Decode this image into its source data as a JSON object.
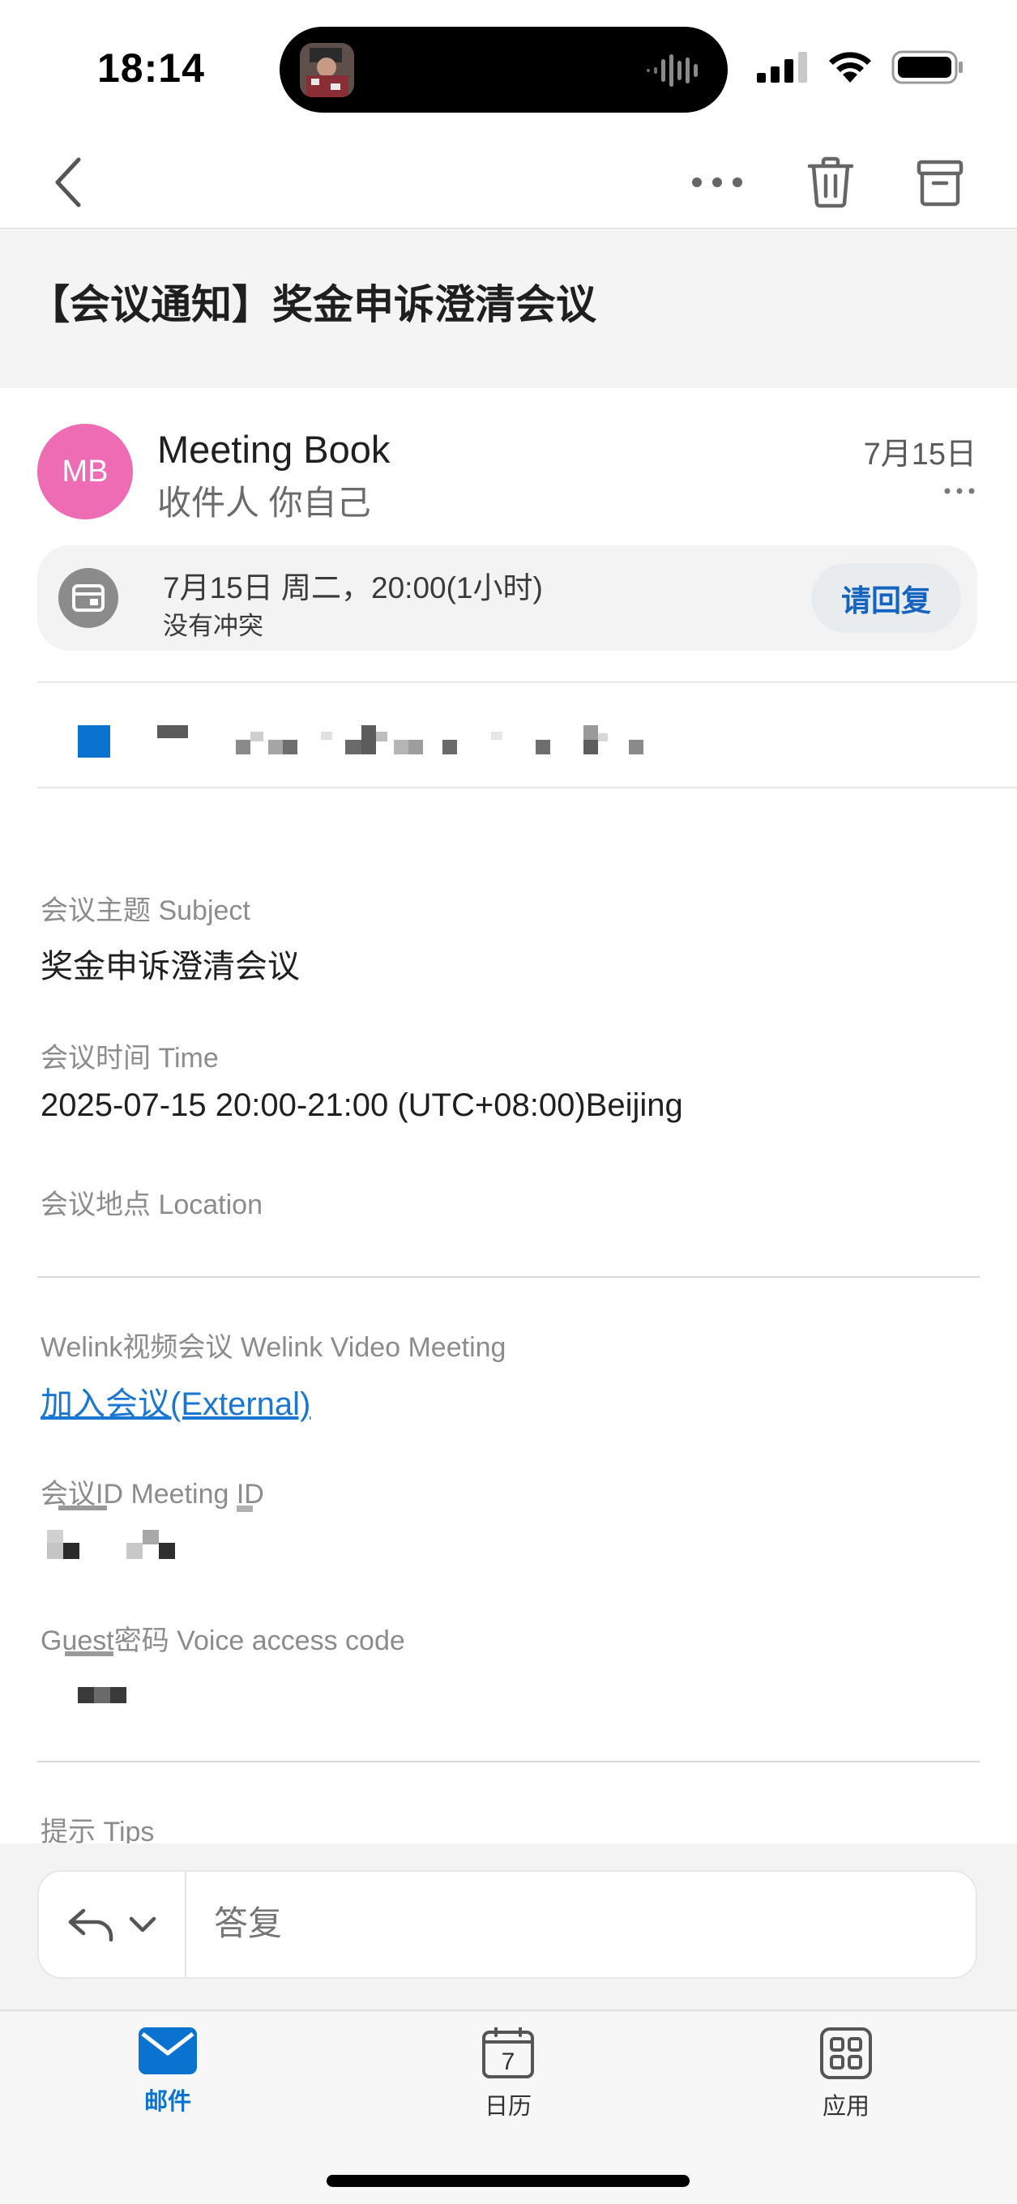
{
  "status_bar": {
    "time": "18:14"
  },
  "email": {
    "subject": "【会议通知】奖金申诉澄清会议",
    "sender": {
      "initials": "MB",
      "name": "Meeting Book",
      "avatar_color": "#ee6cb4"
    },
    "recipient": "收件人 你自己",
    "date": "7月15日"
  },
  "event_card": {
    "time": "7月15日 周二，20:00(1小时)",
    "conflict": "没有冲突",
    "reply_label": "请回复"
  },
  "body": {
    "subject_label": "会议主题 Subject",
    "subject_value": "奖金申诉澄清会议",
    "time_label": "会议时间 Time",
    "time_value": "2025-07-15 20:00-21:00 (UTC+08:00)Beijing",
    "location_label": "会议地点 Location",
    "welink_label": "Welink视频会议 Welink Video Meeting",
    "join_link": "加入会议(External)",
    "meeting_id_label": "会议ID Meeting ID",
    "guest_label": "Guest密码 Voice access code",
    "tips_label": "提示 Tips"
  },
  "reply_bar": {
    "placeholder": "答复"
  },
  "tabs": [
    {
      "label": "邮件",
      "active": true
    },
    {
      "label": "日历",
      "active": false,
      "calendar_day": "7"
    },
    {
      "label": "应用",
      "active": false
    }
  ],
  "colors": {
    "accent": "#1976d2",
    "active_tab": "#0a73d0",
    "inactive_tab": "#333333"
  }
}
